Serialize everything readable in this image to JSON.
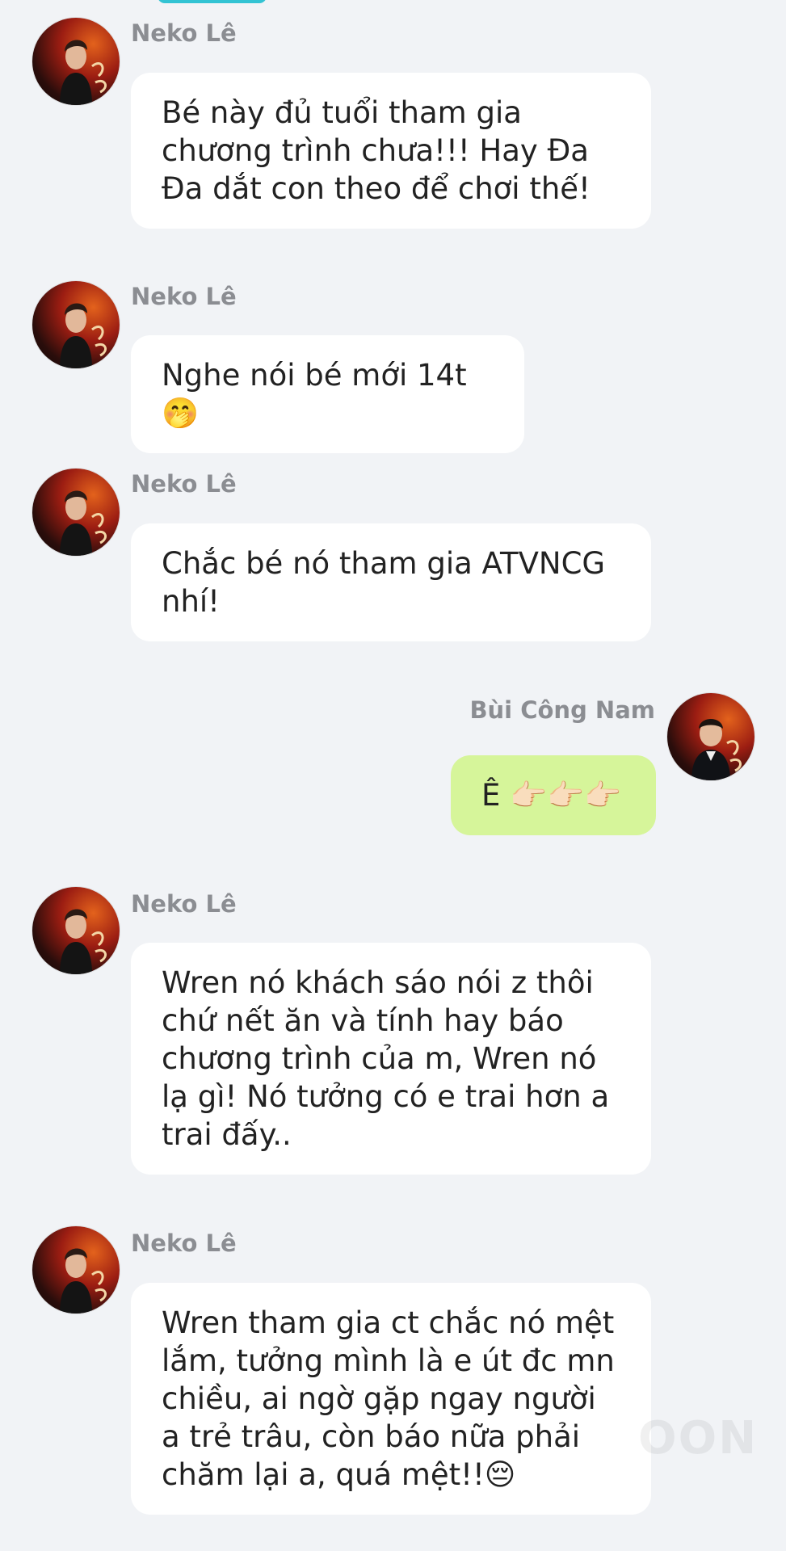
{
  "messages": [
    {
      "sender": "Neko Lê",
      "text": "Bé này đủ tuổi tham gia chương trình chưa!!! Hay Đa Đa dắt con theo để chơi thế!",
      "side": "left"
    },
    {
      "sender": "Neko Lê",
      "text": "Nghe nói bé mới 14t 🤭",
      "side": "left"
    },
    {
      "sender": "Neko Lê",
      "text": "Chắc bé nó tham gia ATVNCG nhí!",
      "side": "left"
    },
    {
      "sender": "Bùi Công Nam",
      "text": "Ê 👉🏻👉🏻👉🏻",
      "side": "right"
    },
    {
      "sender": "Neko Lê",
      "text": "Wren nó khách sáo nói z thôi chứ nết ăn và tính hay báo chương trình của m, Wren nó lạ gì! Nó tưởng có e trai hơn a trai đấy..",
      "side": "left"
    },
    {
      "sender": "Neko Lê",
      "text": "Wren tham gia ct chắc nó mệt lắm, tưởng mình là e út đc mn chiều, ai ngờ gặp ngay người a trẻ trâu, còn báo nữa phải chăm lại a, quá mệt!!😔",
      "side": "left"
    }
  ],
  "watermark": "OON",
  "colors": {
    "background": "#f1f3f6",
    "bubble_in": "#ffffff",
    "bubble_out": "#d6f59a",
    "name_text": "#8b8d92",
    "top_pill": "#33c3d3"
  }
}
